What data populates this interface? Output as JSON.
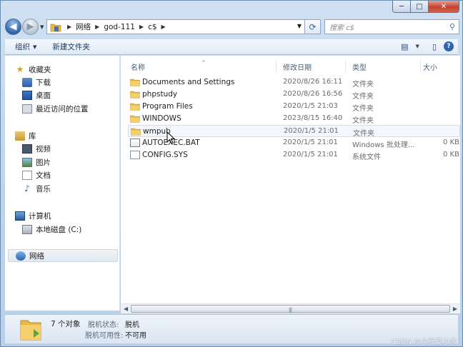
{
  "window": {
    "controls": {
      "minimize": "─",
      "maximize": "□",
      "close": "✕"
    }
  },
  "nav": {
    "back_glyph": "◀",
    "forward_glyph": "▶",
    "breadcrumb": [
      "网络",
      "god-111",
      "c$"
    ],
    "refresh_glyph": "⟳",
    "search_placeholder": "搜索 c$",
    "search_glyph": "⚲"
  },
  "toolbar": {
    "organize": "组织",
    "new_folder": "新建文件夹",
    "views_glyph": "▤",
    "preview_glyph": "▯",
    "help_glyph": "?"
  },
  "sidebar": {
    "favorites": {
      "label": "收藏夹",
      "items": [
        "下载",
        "桌面",
        "最近访问的位置"
      ]
    },
    "libraries": {
      "label": "库",
      "items": [
        "视频",
        "图片",
        "文档",
        "音乐"
      ]
    },
    "computer": {
      "label": "计算机",
      "items": [
        "本地磁盘 (C:)"
      ]
    },
    "network": {
      "label": "网络"
    }
  },
  "columns": {
    "name": "名称",
    "date": "修改日期",
    "type": "类型",
    "size": "大小"
  },
  "files": [
    {
      "name": "Documents and Settings",
      "date": "2020/8/26 16:11",
      "type": "文件夹",
      "size": "",
      "kind": "folder"
    },
    {
      "name": "phpstudy",
      "date": "2020/8/26 16:56",
      "type": "文件夹",
      "size": "",
      "kind": "folder"
    },
    {
      "name": "Program Files",
      "date": "2020/1/5 21:03",
      "type": "文件夹",
      "size": "",
      "kind": "folder"
    },
    {
      "name": "WINDOWS",
      "date": "2023/8/15 16:40",
      "type": "文件夹",
      "size": "",
      "kind": "folder"
    },
    {
      "name": "wmpub",
      "date": "2020/1/5 21:01",
      "type": "文件夹",
      "size": "",
      "kind": "folder"
    },
    {
      "name": "AUTOEXEC.BAT",
      "date": "2020/1/5 21:01",
      "type": "Windows 批处理...",
      "size": "0 KB",
      "kind": "bat"
    },
    {
      "name": "CONFIG.SYS",
      "date": "2020/1/5 21:01",
      "type": "系统文件",
      "size": "0 KB",
      "kind": "sys"
    }
  ],
  "details": {
    "count": "7 个对象",
    "offline_status_label": "脱机状态:",
    "offline_status_value": "脱机",
    "offline_avail_label": "脱机可用性:",
    "offline_avail_value": "不可用"
  },
  "watermark": "CSDN @小张爱小余",
  "colors": {
    "accent": "#2d63a8",
    "frame": "#bcd3ec",
    "folder": "#e8b84a"
  }
}
